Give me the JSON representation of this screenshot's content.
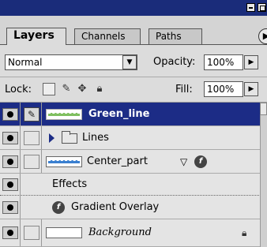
{
  "tabs": [
    {
      "label": "Layers",
      "active": true
    },
    {
      "label": "Channels",
      "active": false
    },
    {
      "label": "Paths",
      "active": false
    }
  ],
  "blend": {
    "mode": "Normal",
    "opacity_label": "Opacity:",
    "opacity_value": "100%"
  },
  "lock": {
    "label": "Lock:",
    "fill_label": "Fill:",
    "fill_value": "100%",
    "icons": [
      "lock-transparency-icon",
      "lock-paint-icon",
      "lock-move-icon",
      "lock-all-icon"
    ]
  },
  "layers": [
    {
      "name": "Green_line",
      "selected": true,
      "visible": true
    },
    {
      "name": "Lines",
      "type": "group",
      "visible": true
    },
    {
      "name": "Center_part",
      "visible": true,
      "has_effects": true
    },
    {
      "name": "Effects",
      "type": "effects-header"
    },
    {
      "name": "Gradient Overlay",
      "type": "effect"
    },
    {
      "name": "Background",
      "visible": true,
      "locked": true
    }
  ],
  "colors": {
    "titlebar": "#1a2c7a",
    "selection": "#1c2c86",
    "panel": "#dcdcdc"
  }
}
